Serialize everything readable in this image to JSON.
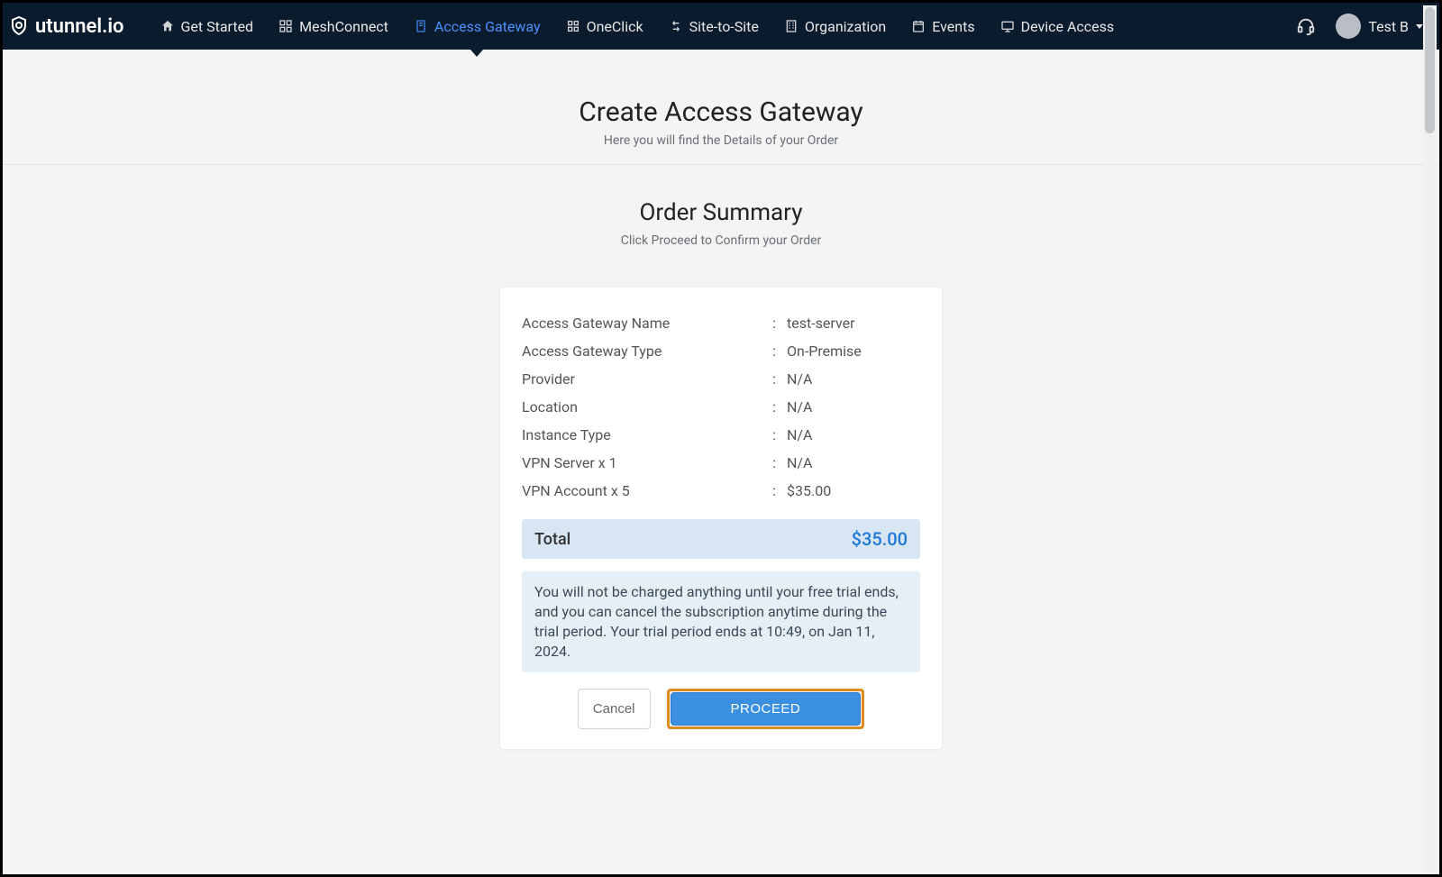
{
  "brand": {
    "name": "utunnel.io"
  },
  "nav": {
    "items": [
      {
        "label": "Get Started",
        "icon": "home-icon",
        "active": false
      },
      {
        "label": "MeshConnect",
        "icon": "mesh-icon",
        "active": false
      },
      {
        "label": "Access Gateway",
        "icon": "gateway-icon",
        "active": true
      },
      {
        "label": "OneClick",
        "icon": "oneclick-icon",
        "active": false
      },
      {
        "label": "Site-to-Site",
        "icon": "sitetosite-icon",
        "active": false
      },
      {
        "label": "Organization",
        "icon": "org-icon",
        "active": false
      },
      {
        "label": "Events",
        "icon": "events-icon",
        "active": false
      },
      {
        "label": "Device Access",
        "icon": "device-icon",
        "active": false
      }
    ]
  },
  "user": {
    "name": "Test B"
  },
  "page": {
    "title": "Create Access Gateway",
    "subtitle": "Here you will find the Details of your Order"
  },
  "summary": {
    "title": "Order Summary",
    "subtitle": "Click Proceed to Confirm your Order",
    "rows": [
      {
        "label": "Access Gateway Name",
        "value": "test-server"
      },
      {
        "label": "Access Gateway Type",
        "value": "On-Premise"
      },
      {
        "label": "Provider",
        "value": "N/A"
      },
      {
        "label": "Location",
        "value": "N/A"
      },
      {
        "label": "Instance Type",
        "value": "N/A"
      },
      {
        "label": "VPN Server x 1",
        "value": "N/A"
      },
      {
        "label": "VPN Account x 5",
        "value": "$35.00"
      }
    ],
    "total_label": "Total",
    "total_value": "$35.00",
    "notice": "You will not be charged anything until your free trial ends, and you can cancel the subscription anytime during the trial period. Your trial period ends at 10:49, on Jan 11, 2024."
  },
  "actions": {
    "cancel": "Cancel",
    "proceed": "PROCEED"
  }
}
